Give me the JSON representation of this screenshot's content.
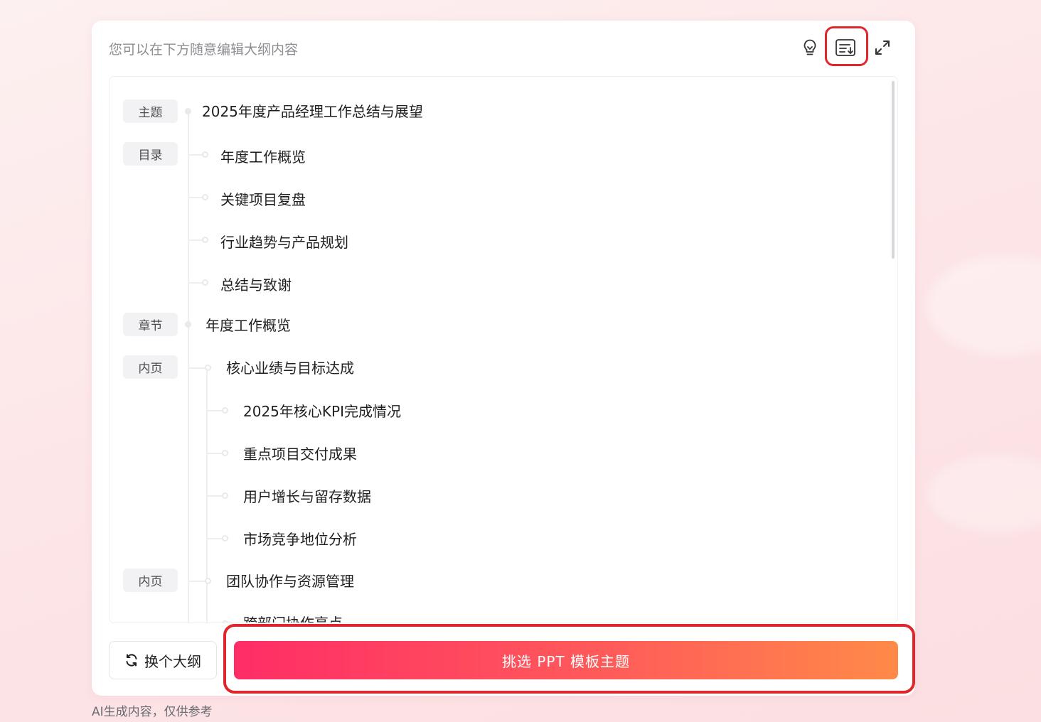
{
  "header": {
    "hint": "您可以在下方随意编辑大纲内容",
    "icons": [
      "lightbulb-icon",
      "download-outline-icon",
      "expand-icon"
    ]
  },
  "outline": {
    "tags": {
      "topic": "主题",
      "toc": "目录",
      "chapter": "章节",
      "page1": "内页",
      "page2": "内页"
    },
    "topic": "2025年度产品经理工作总结与展望",
    "toc_items": [
      "年度工作概览",
      "关键项目复盘",
      "行业趋势与产品规划",
      "总结与致谢"
    ],
    "chapter": "年度工作概览",
    "page1": {
      "title": "核心业绩与目标达成",
      "items": [
        "2025年核心KPI完成情况",
        "重点项目交付成果",
        "用户增长与留存数据",
        "市场竞争地位分析"
      ]
    },
    "page2": {
      "title": "团队协作与资源管理",
      "items": [
        "跨部门协作亮点"
      ]
    }
  },
  "footer": {
    "change_label": "换个大纲",
    "primary_label": "挑选 PPT 模板主题"
  },
  "disclaimer": "AI生成内容，仅供参考",
  "colors": {
    "highlight": "#e0262b",
    "primary_start": "#ff2d66",
    "primary_end": "#ff8a48"
  }
}
